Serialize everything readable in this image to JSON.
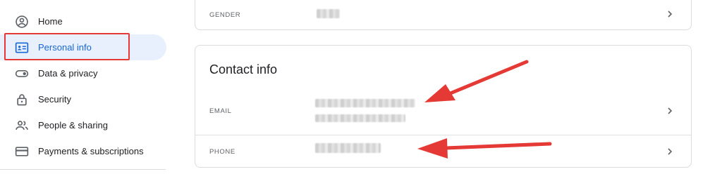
{
  "sidebar": {
    "items": [
      {
        "label": "Home",
        "icon": "account-circle-icon"
      },
      {
        "label": "Personal info",
        "icon": "id-card-icon",
        "active": true
      },
      {
        "label": "Data & privacy",
        "icon": "toggle-icon"
      },
      {
        "label": "Security",
        "icon": "lock-icon"
      },
      {
        "label": "People & sharing",
        "icon": "people-icon"
      },
      {
        "label": "Payments & subscriptions",
        "icon": "credit-card-icon"
      }
    ]
  },
  "basic_info": {
    "gender": {
      "label": "GENDER",
      "value_redacted": true
    }
  },
  "contact_info": {
    "title": "Contact info",
    "email": {
      "label": "EMAIL",
      "value_redacted": true
    },
    "phone": {
      "label": "PHONE",
      "value_redacted": true
    }
  },
  "colors": {
    "accent": "#1967d2",
    "active_bg": "#e8f0fe",
    "annotation_red": "#e53935",
    "border": "#dadce0",
    "text_secondary": "#5f6368"
  }
}
